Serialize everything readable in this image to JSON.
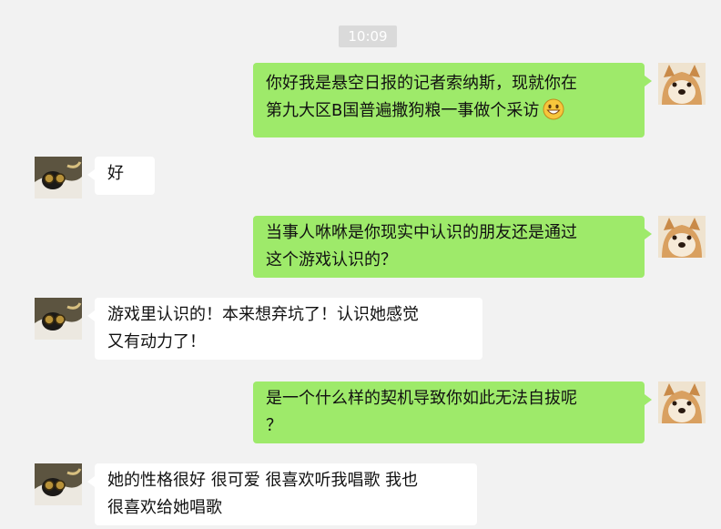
{
  "chat": {
    "timestamp": "10:09",
    "messages": [
      {
        "side": "out",
        "line1": "你好我是悬空日报的记者索纳斯，现就你在",
        "line2": "第九大区B国普遍撒狗粮一事做个采访",
        "emoji": "grinning-face-emoji"
      },
      {
        "side": "in",
        "line1": "好"
      },
      {
        "side": "out",
        "line1": "当事人咻咻是你现实中认识的朋友还是通过",
        "line2": "这个游戏认识的？"
      },
      {
        "side": "in",
        "line1": "游戏里认识的！本来想弃坑了！认识她感觉",
        "line2": "又有动力了！"
      },
      {
        "side": "out",
        "line1": "是一个什么样的契机导致你如此无法自拔呢",
        "line2": "？"
      },
      {
        "side": "in",
        "line1": "她的性格很好 很可爱 很喜欢听我唱歌 我也",
        "line2": "很喜欢给她唱歌"
      }
    ]
  },
  "colors": {
    "background": "#f2f2f2",
    "outgoing_bubble": "#9eea6a",
    "incoming_bubble": "#ffffff",
    "timestamp_bg": "#dadada"
  },
  "icons": {
    "self_avatar": "shiba-dog-avatar",
    "contact_avatar": "dog-with-goggles-avatar"
  }
}
